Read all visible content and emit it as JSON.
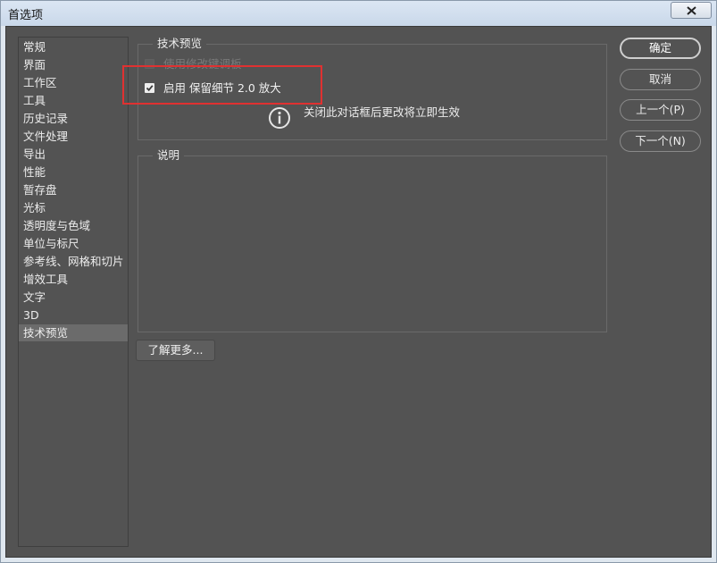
{
  "window": {
    "title": "首选项"
  },
  "sidebar": {
    "items": [
      {
        "label": "常规"
      },
      {
        "label": "界面"
      },
      {
        "label": "工作区"
      },
      {
        "label": "工具"
      },
      {
        "label": "历史记录"
      },
      {
        "label": "文件处理"
      },
      {
        "label": "导出"
      },
      {
        "label": "性能"
      },
      {
        "label": "暂存盘"
      },
      {
        "label": "光标"
      },
      {
        "label": "透明度与色域"
      },
      {
        "label": "单位与标尺"
      },
      {
        "label": "参考线、网格和切片"
      },
      {
        "label": "增效工具"
      },
      {
        "label": "文字"
      },
      {
        "label": "3D"
      },
      {
        "label": "技术预览"
      }
    ],
    "selected": "技术预览"
  },
  "tech_preview": {
    "group_label": "技术预览",
    "option1": {
      "label": "使用修改键调板",
      "checked": false,
      "disabled": true
    },
    "option2": {
      "label": "启用 保留细节 2.0 放大",
      "checked": true,
      "disabled": false
    },
    "info_text": "关闭此对话框后更改将立即生效"
  },
  "description": {
    "group_label": "说明"
  },
  "learn_more": {
    "label": "了解更多..."
  },
  "buttons": {
    "ok": "确定",
    "cancel": "取消",
    "prev": "上一个(P)",
    "next": "下一个(N)"
  },
  "colors": {
    "panel_bg": "#535353",
    "highlight": "#e03131"
  }
}
